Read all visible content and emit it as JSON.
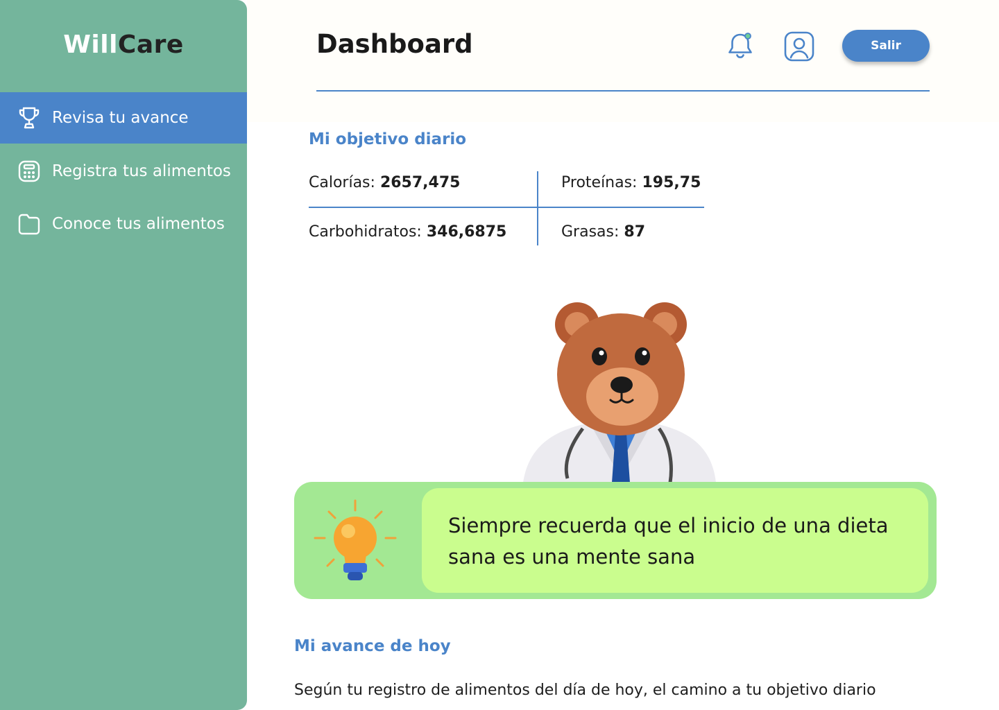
{
  "app": {
    "logo_part1": "Will",
    "logo_part2": "Care"
  },
  "sidebar": {
    "items": [
      {
        "label": "Revisa tu avance",
        "icon": "trophy-icon",
        "active": true
      },
      {
        "label": "Registra tus alimentos",
        "icon": "calculator-icon",
        "active": false
      },
      {
        "label": "Conoce tus alimentos",
        "icon": "folder-icon",
        "active": false
      }
    ]
  },
  "header": {
    "title": "Dashboard",
    "logout_label": "Salir",
    "notification_icon": "bell-icon",
    "profile_icon": "user-profile-icon"
  },
  "daily_goal": {
    "title": "Mi objetivo diario",
    "calories_label": "Calorías:",
    "calories_value": "2657,475",
    "proteins_label": "Proteínas:",
    "proteins_value": "195,75",
    "carbs_label": "Carbohidratos:",
    "carbs_value": "346,6875",
    "fats_label": "Grasas:",
    "fats_value": "87"
  },
  "tip": {
    "text": "Siempre recuerda que el inicio de una dieta sana es una mente sana",
    "icon": "lightbulb-icon"
  },
  "progress": {
    "title": "Mi avance de hoy",
    "text": "Según tu registro de alimentos del día de hoy, el camino a tu objetivo diario"
  },
  "colors": {
    "sidebar_bg": "#74b59c",
    "accent": "#4a84c9",
    "tip_outer": "#a3e893",
    "tip_inner": "#cafd8e"
  }
}
